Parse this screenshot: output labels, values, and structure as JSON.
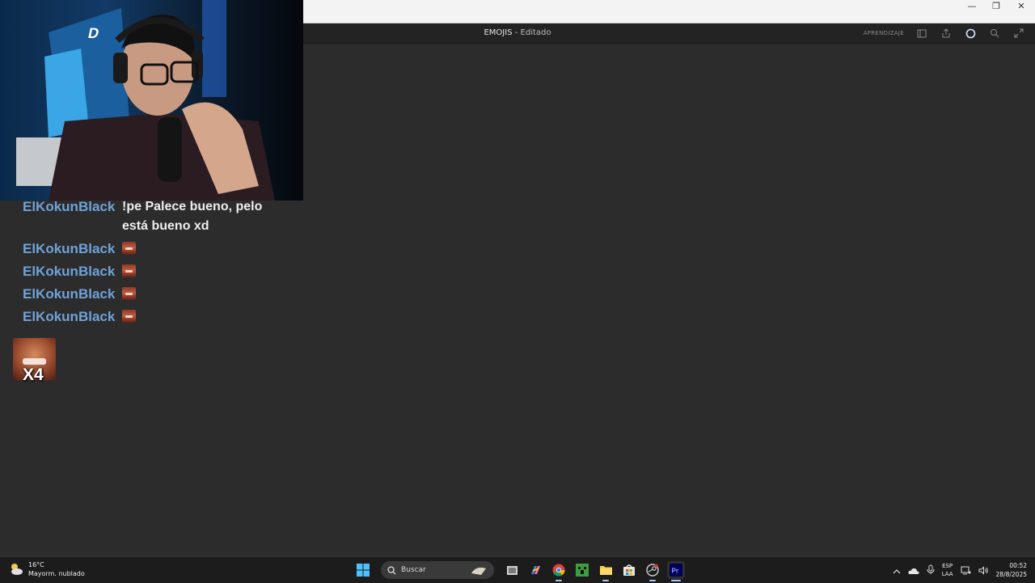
{
  "window": {
    "minimize_glyph": "—",
    "restore_glyph": "❐",
    "close_glyph": "✕"
  },
  "app_header": {
    "project_name": "EMOJIS",
    "separator": "-",
    "status": "Editado",
    "learn_label": "APRENDIZAJE",
    "icons": [
      "panel-icon",
      "share-icon",
      "progress-icon",
      "search-icon",
      "fullscreen-icon"
    ]
  },
  "webcam": {
    "description_icon": "webcam-feed"
  },
  "chat": {
    "messages": [
      {
        "user": "ElKokunBlack",
        "text": "!pe Palece bueno, pelo está bueno xd"
      },
      {
        "user": "ElKokunBlack",
        "emote": "laughing-emote"
      },
      {
        "user": "ElKokunBlack",
        "emote": "laughing-emote"
      },
      {
        "user": "ElKokunBlack",
        "emote": "laughing-emote"
      },
      {
        "user": "ElKokunBlack",
        "emote": "laughing-emote"
      }
    ],
    "combo_label": "X4"
  },
  "taskbar": {
    "weather_temp": "16°C",
    "weather_desc": "Mayorm. nublado",
    "search_placeholder": "Buscar",
    "apps": [
      "windows-start-icon",
      "task-view-icon",
      "copilot-icon",
      "chrome-icon",
      "minecraft-icon",
      "file-explorer-icon",
      "store-icon",
      "steam-icon",
      "premiere-icon"
    ],
    "lang_line1": "ESP",
    "lang_line2": "LAA",
    "time": "00:52",
    "date": "28/8/2025"
  },
  "colors": {
    "accent_username": "#6fa2d9",
    "premiere_purple": "#9999ff",
    "background": "#2c2c2c"
  }
}
